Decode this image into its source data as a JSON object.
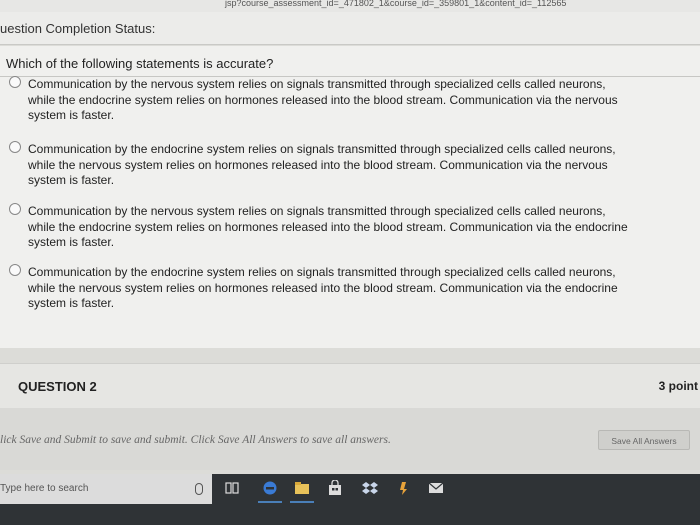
{
  "browser": {
    "url_fragment": "jsp?course_assessment_id=_471802_1&course_id=_359801_1&content_id=_112565"
  },
  "status_header": {
    "label": "uestion Completion Status:"
  },
  "question1": {
    "prompt": "Which of the following statements is accurate?",
    "options": [
      {
        "text": "Communication by the nervous system relies on signals transmitted through specialized cells called neurons, while the endocrine system relies on hormones released into the blood stream. Communication via the nervous system is faster."
      },
      {
        "text": "Communication by the endocrine system relies on signals transmitted through specialized cells called neurons, while the nervous system relies on hormones released into the blood stream. Communication via the nervous system is faster."
      },
      {
        "text": "Communication by the nervous system relies on signals transmitted through specialized cells called neurons, while the endocrine system relies on hormones released into the blood stream. Communication via the endocrine system is faster."
      },
      {
        "text": "Communication by the endocrine system relies on signals transmitted through specialized cells called neurons, while the nervous system relies on hormones released into the blood stream. Communication via the endocrine system is faster."
      }
    ]
  },
  "question2": {
    "title": "QUESTION 2",
    "points": "3 point"
  },
  "submit": {
    "instructions": "lick Save and Submit to save and submit. Click Save All Answers to save all answers.",
    "save_all_label": "Save All Answers"
  },
  "taskbar": {
    "search_placeholder": "Type here to search",
    "icons": [
      "microphone-icon",
      "task-view-icon",
      "edge-icon",
      "file-explorer-icon",
      "store-icon",
      "dropbox-icon",
      "amazon-icon",
      "mail-icon"
    ]
  }
}
